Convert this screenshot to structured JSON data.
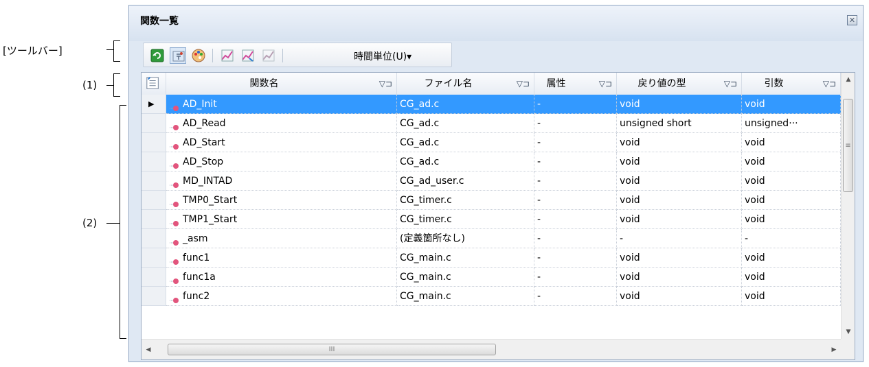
{
  "annotations": {
    "toolbar": "[ツールバー]",
    "header": "(1)",
    "list": "(2)"
  },
  "panel": {
    "title": "関数一覧",
    "close_icon": "close-icon"
  },
  "toolbar": {
    "buttons": [
      {
        "name": "refresh-icon"
      },
      {
        "name": "jump-icon"
      },
      {
        "name": "color-icon"
      },
      {
        "name": "profile-icon"
      },
      {
        "name": "profile-reset-icon"
      },
      {
        "name": "profile-clear-icon"
      }
    ],
    "time_unit_label": "時間単位(U)▾"
  },
  "columns": [
    {
      "label": "関数名",
      "filter": "▽⊐"
    },
    {
      "label": "ファイル名",
      "filter": "▽⊐"
    },
    {
      "label": "属性",
      "filter": "▽⊐"
    },
    {
      "label": "戻り値の型",
      "filter": "▽⊐"
    },
    {
      "label": "引数",
      "filter": "▽⊐"
    }
  ],
  "rows": [
    {
      "name": "AD_Init",
      "file": "CG_ad.c",
      "attr": "-",
      "ret": "void",
      "args": "void",
      "selected": true
    },
    {
      "name": "AD_Read",
      "file": "CG_ad.c",
      "attr": "-",
      "ret": "unsigned short",
      "args": "unsigned···"
    },
    {
      "name": "AD_Start",
      "file": "CG_ad.c",
      "attr": "-",
      "ret": "void",
      "args": "void"
    },
    {
      "name": "AD_Stop",
      "file": "CG_ad.c",
      "attr": "-",
      "ret": "void",
      "args": "void"
    },
    {
      "name": "MD_INTAD",
      "file": "CG_ad_user.c",
      "attr": "-",
      "ret": "void",
      "args": "void"
    },
    {
      "name": "TMP0_Start",
      "file": "CG_timer.c",
      "attr": "-",
      "ret": "void",
      "args": "void"
    },
    {
      "name": "TMP1_Start",
      "file": "CG_timer.c",
      "attr": "-",
      "ret": "void",
      "args": "void"
    },
    {
      "name": "_asm",
      "file": "(定義箇所なし)",
      "attr": "-",
      "ret": "-",
      "args": "-"
    },
    {
      "name": "func1",
      "file": "CG_main.c",
      "attr": "-",
      "ret": "void",
      "args": "void"
    },
    {
      "name": "func1a",
      "file": "CG_main.c",
      "attr": "-",
      "ret": "void",
      "args": "void"
    },
    {
      "name": "func2",
      "file": "CG_main.c",
      "attr": "-",
      "ret": "void",
      "args": "void"
    }
  ],
  "scroll": {
    "thumb_grip": "III",
    "v_thumb_grip": "≡",
    "up": "▲",
    "down": "▼",
    "left": "◀",
    "right": "▶"
  },
  "colors": {
    "selection": "#3399ff",
    "panel_bg": "#dfe8f3"
  }
}
